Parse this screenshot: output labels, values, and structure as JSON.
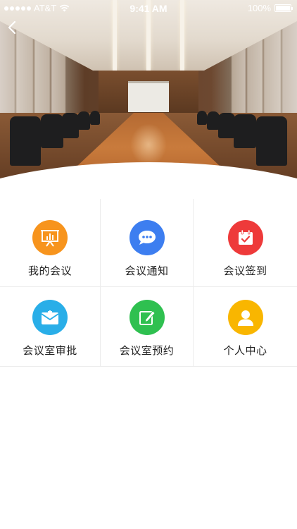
{
  "status_bar": {
    "carrier": "AT&T",
    "time": "9:41 AM",
    "battery": "100%",
    "battery_level": 1.0
  },
  "hero": {
    "icon": "conference-room-photo"
  },
  "navigation": {
    "back_icon": "chevron-left-icon"
  },
  "menu": {
    "items": [
      {
        "label": "我的会议",
        "icon": "presentation-board-icon",
        "color": "#f7941d"
      },
      {
        "label": "会议通知",
        "icon": "chat-bubble-icon",
        "color": "#3d7ef0"
      },
      {
        "label": "会议签到",
        "icon": "calendar-check-icon",
        "color": "#ee3a3a"
      },
      {
        "label": "会议室审批",
        "icon": "envelope-icon",
        "color": "#29aee8"
      },
      {
        "label": "会议室预约",
        "icon": "pencil-edit-icon",
        "color": "#2fc050"
      },
      {
        "label": "个人中心",
        "icon": "user-profile-icon",
        "color": "#f9b600"
      }
    ]
  }
}
